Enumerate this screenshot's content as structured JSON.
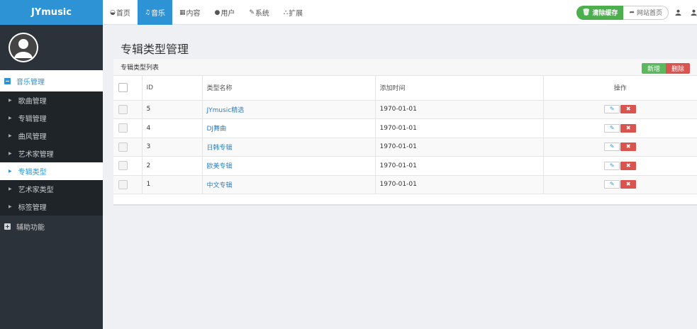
{
  "brand": "JYmusic",
  "nav": [
    {
      "icon": "dashboard-icon",
      "glyph": "◒",
      "label": "首页",
      "active": false
    },
    {
      "icon": "music-icon",
      "glyph": "♫",
      "label": "音乐",
      "active": true
    },
    {
      "icon": "content-icon",
      "glyph": "▦",
      "label": "内容",
      "active": false
    },
    {
      "icon": "user-icon",
      "glyph": "👤",
      "label": "用户",
      "active": false
    },
    {
      "icon": "wrench-icon",
      "glyph": "✎",
      "label": "系统",
      "active": false
    },
    {
      "icon": "sitemap-icon",
      "glyph": "⛬",
      "label": "扩展",
      "active": false
    }
  ],
  "toolbar": {
    "clear_cache": "清除缓存",
    "site_home": "网站首页"
  },
  "sidebar": {
    "group_music": "音乐管理",
    "items": [
      {
        "label": "歌曲管理",
        "active": false
      },
      {
        "label": "专辑管理",
        "active": false
      },
      {
        "label": "曲风管理",
        "active": false
      },
      {
        "label": "艺术家管理",
        "active": false
      },
      {
        "label": "专辑类型",
        "active": true
      },
      {
        "label": "艺术家类型",
        "active": false
      },
      {
        "label": "标签管理",
        "active": false
      }
    ],
    "group_aux": "辅助功能"
  },
  "page_title": "专辑类型管理",
  "panel": {
    "title": "专辑类型列表",
    "add_label": "新增",
    "delete_label": "删除"
  },
  "table": {
    "headers": {
      "id": "ID",
      "name": "类型名称",
      "time": "添加时间",
      "ops": "操作"
    },
    "rows": [
      {
        "id": "5",
        "name": "JYmusic精选",
        "time": "1970-01-01"
      },
      {
        "id": "4",
        "name": "DJ舞曲",
        "time": "1970-01-01"
      },
      {
        "id": "3",
        "name": "日韩专辑",
        "time": "1970-01-01"
      },
      {
        "id": "2",
        "name": "欧美专辑",
        "time": "1970-01-01"
      },
      {
        "id": "1",
        "name": "中文专辑",
        "time": "1970-01-01"
      }
    ]
  },
  "colors": {
    "accent": "#2e93d4",
    "success": "#5cb85c",
    "danger": "#d9534f",
    "sidebar": "#2b323a"
  }
}
